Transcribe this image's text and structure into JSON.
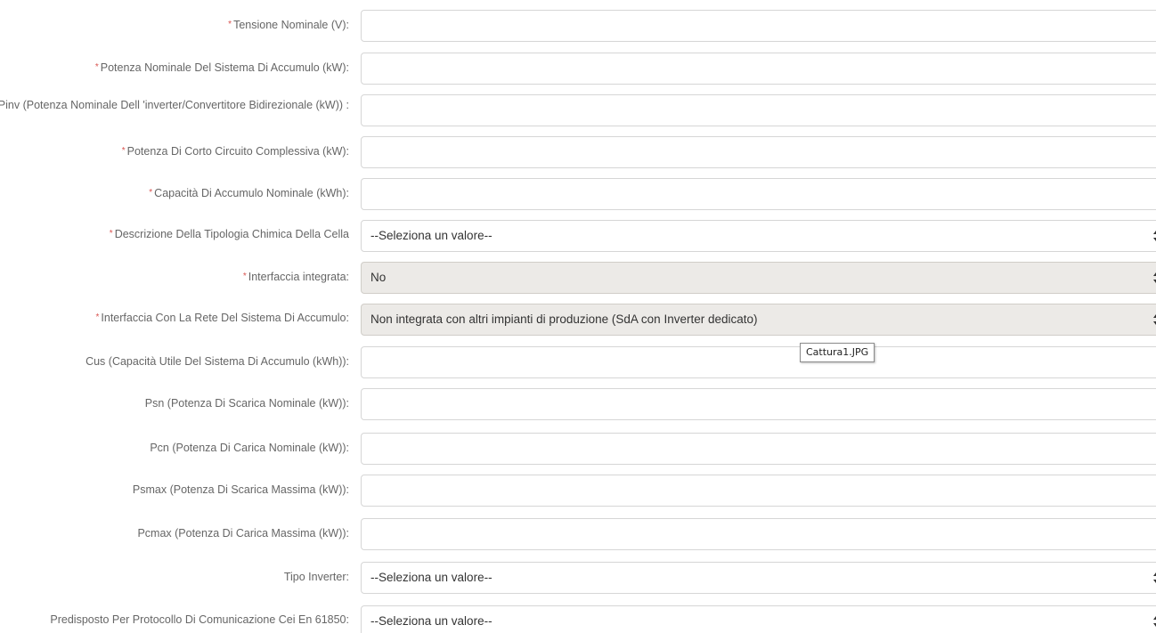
{
  "form": {
    "rows": [
      {
        "label": "Tensione Nominale (V):",
        "required": true,
        "type": "input",
        "value": ""
      },
      {
        "label": "Potenza Nominale Del Sistema Di Accumulo (kW):",
        "required": true,
        "type": "input",
        "value": ""
      },
      {
        "label": "Pinv (Potenza Nominale Dell 'inverter/Convertitore Bidirezionale (kW)) :",
        "required": false,
        "type": "input",
        "value": ""
      },
      {
        "label": "Potenza Di Corto Circuito Complessiva (kW):",
        "required": true,
        "type": "input",
        "value": ""
      },
      {
        "label": "Capacità Di Accumulo Nominale (kWh):",
        "required": true,
        "type": "input",
        "value": ""
      },
      {
        "label": "Descrizione Della Tipologia Chimica Della Cella",
        "required": true,
        "type": "select",
        "value": "--Seleziona un valore--"
      },
      {
        "label": "Interfaccia integrata:",
        "required": true,
        "type": "select-disabled",
        "value": "No"
      },
      {
        "label": "Interfaccia Con La Rete Del Sistema Di Accumulo:",
        "required": true,
        "type": "select-disabled",
        "value": "Non integrata con altri impianti di produzione (SdA con Inverter dedicato)"
      },
      {
        "label": "Cus (Capacità Utile Del Sistema Di Accumulo (kWh)):",
        "required": false,
        "type": "input",
        "value": ""
      },
      {
        "label": "Psn (Potenza Di Scarica Nominale (kW)):",
        "required": false,
        "type": "input",
        "value": ""
      },
      {
        "label": "Pcn (Potenza Di Carica Nominale (kW)):",
        "required": false,
        "type": "input",
        "value": ""
      },
      {
        "label": "Psmax (Potenza Di Scarica Massima (kW)):",
        "required": false,
        "type": "input",
        "value": ""
      },
      {
        "label": "Pcmax (Potenza Di Carica Massima (kW)):",
        "required": false,
        "type": "input",
        "value": ""
      },
      {
        "label": "Tipo Inverter:",
        "required": false,
        "type": "select",
        "value": "--Seleziona un valore--"
      },
      {
        "label": "Predisposto Per Protocollo Di Comunicazione Cei En 61850:",
        "required": false,
        "type": "select",
        "value": "--Seleziona un valore--"
      }
    ],
    "required_marker": "*"
  },
  "tooltip": {
    "text": "Cattura1.JPG"
  },
  "colors": {
    "label_text": "#666666",
    "required_marker": "#d9534f",
    "field_border": "#d6d6d6",
    "disabled_bg": "#eceae7"
  }
}
